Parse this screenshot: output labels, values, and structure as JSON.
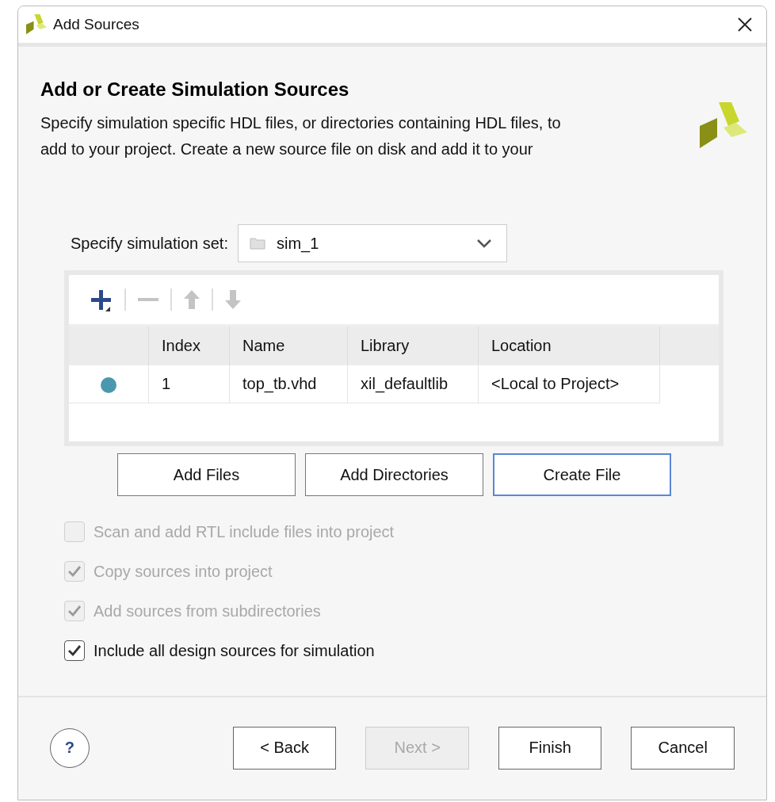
{
  "window": {
    "title": "Add Sources"
  },
  "header": {
    "title": "Add or Create Simulation Sources",
    "description_lines": [
      "Specify simulation specific HDL files, or directories containing HDL files, to",
      "add to your project. Create a new source file on disk and add it to your"
    ]
  },
  "simulation_set": {
    "label": "Specify simulation set:",
    "value": "sim_1"
  },
  "toolbar": [
    {
      "kind": "add",
      "disabled": false
    },
    {
      "kind": "remove",
      "disabled": true
    },
    {
      "kind": "up",
      "disabled": true
    },
    {
      "kind": "down",
      "disabled": true
    }
  ],
  "table": {
    "columns": [
      "Index",
      "Name",
      "Library",
      "Location"
    ],
    "rows": [
      {
        "color": "#4a98b0",
        "cells": [
          "1",
          "top_tb.vhd",
          "xil_defaultlib",
          "<Local to Project>"
        ]
      }
    ]
  },
  "file_buttons": [
    {
      "label": "Add Files",
      "focused": false
    },
    {
      "label": "Add Directories",
      "focused": false
    },
    {
      "label": "Create File",
      "focused": true
    }
  ],
  "options": [
    {
      "label": "Scan and add RTL include files into project",
      "checked": false,
      "disabled": true
    },
    {
      "label": "Copy sources into project",
      "checked": true,
      "disabled": true
    },
    {
      "label": "Add sources from subdirectories",
      "checked": true,
      "disabled": true
    },
    {
      "label": "Include all design sources for simulation",
      "checked": true,
      "disabled": false
    }
  ],
  "help_button": {
    "label": "?"
  },
  "footer_buttons": [
    {
      "label": "< Back",
      "disabled": false
    },
    {
      "label": "Next >",
      "disabled": true
    },
    {
      "label": "Finish",
      "disabled": false
    },
    {
      "label": "Cancel",
      "disabled": false
    }
  ]
}
